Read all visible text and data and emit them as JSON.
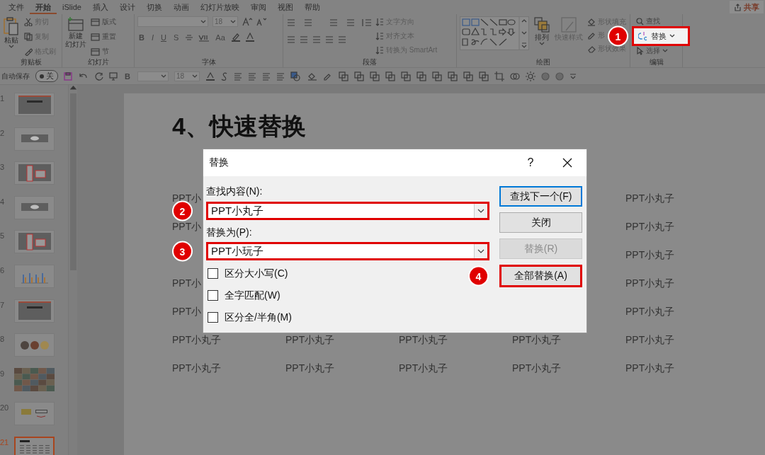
{
  "menu": {
    "tabs": [
      {
        "label": "文件",
        "selected": false
      },
      {
        "label": "开始",
        "selected": true
      },
      {
        "label": "iSlide",
        "selected": false
      },
      {
        "label": "插入",
        "selected": false
      },
      {
        "label": "设计",
        "selected": false
      },
      {
        "label": "切换",
        "selected": false
      },
      {
        "label": "动画",
        "selected": false
      },
      {
        "label": "幻灯片放映",
        "selected": false
      },
      {
        "label": "审阅",
        "selected": false
      },
      {
        "label": "视图",
        "selected": false
      },
      {
        "label": "帮助",
        "selected": false
      }
    ],
    "share": "共享"
  },
  "ribbon": {
    "clipboard": {
      "label": "剪贴板",
      "paste": "粘贴",
      "items": [
        "剪切",
        "复制",
        "格式刷"
      ]
    },
    "slides": {
      "label": "幻灯片",
      "new_slide": [
        "新建",
        "幻灯片"
      ],
      "items": [
        "版式",
        "重置",
        "节"
      ]
    },
    "font": {
      "label": "字体",
      "size": "18",
      "format_buttons": [
        "B",
        "I",
        "U",
        "S"
      ],
      "case_button": "Aa"
    },
    "paragraph": {
      "label": "段落",
      "items": [
        "文字方向",
        "对齐文本",
        "转换为 SmartArt"
      ]
    },
    "drawing": {
      "label": "绘图",
      "arrange": "排列",
      "quick_styles": "快速样式",
      "items": [
        "形状填充",
        "形",
        "形状效果"
      ]
    },
    "editing": {
      "label": "编辑",
      "find": "查找",
      "replace": {
        "label": "替换",
        "highlighted": true,
        "step": "1"
      },
      "select": "选择"
    }
  },
  "quick_access": {
    "autosave": "自动保存",
    "toggle": "关",
    "bold": "B",
    "size": "18"
  },
  "thumbnails": [
    {
      "number": "1",
      "kind": "screen",
      "selected": false
    },
    {
      "number": "2",
      "kind": "bubble",
      "selected": false
    },
    {
      "number": "3",
      "kind": "dialog",
      "selected": false
    },
    {
      "number": "4",
      "kind": "bubble",
      "selected": false
    },
    {
      "number": "5",
      "kind": "dialog",
      "selected": false
    },
    {
      "number": "6",
      "kind": "chart",
      "selected": false
    },
    {
      "number": "7",
      "kind": "screen",
      "selected": false
    },
    {
      "number": "8",
      "kind": "circles",
      "selected": false
    },
    {
      "number": "9",
      "kind": "photos",
      "selected": false
    },
    {
      "number": "20",
      "kind": "poster",
      "selected": false
    },
    {
      "number": "21",
      "kind": "table",
      "selected": true
    }
  ],
  "slide": {
    "title": "4、快速替换",
    "partial_rows": [
      {
        "left": "PPT小",
        "right": "PPT小丸子"
      },
      {
        "left": "PPT小",
        "right": "PPT小丸子"
      },
      {
        "right": "PPT小丸子"
      },
      {
        "left": "PPT小",
        "right": "PPT小丸子"
      },
      {
        "left": "PPT小",
        "right": "PPT小丸子"
      }
    ],
    "full_rows": [
      [
        "PPT小丸子",
        "PPT小丸子",
        "PPT小丸子",
        "PPT小丸子",
        "PPT小丸子"
      ],
      [
        "PPT小丸子",
        "PPT小丸子",
        "PPT小丸子",
        "PPT小丸子",
        "PPT小丸子"
      ]
    ]
  },
  "dialog": {
    "title": "替换",
    "help": "?",
    "find": {
      "label": "查找内容(N):",
      "value": "PPT小丸子",
      "highlighted": true,
      "step": "2"
    },
    "replace": {
      "label": "替换为(P):",
      "value": "PPT小玩子",
      "highlighted": true,
      "step": "3"
    },
    "options": [
      {
        "label": "区分大小写(C)",
        "checked": false
      },
      {
        "label": "全字匹配(W)",
        "checked": false
      },
      {
        "label": "区分全/半角(M)",
        "checked": false
      }
    ],
    "buttons": [
      {
        "label": "查找下一个(F)",
        "default": true,
        "disabled": false,
        "highlighted": false
      },
      {
        "label": "关闭",
        "default": false,
        "disabled": false,
        "highlighted": false
      },
      {
        "label": "替换(R)",
        "default": false,
        "disabled": true,
        "highlighted": false
      },
      {
        "label": "全部替换(A)",
        "default": false,
        "disabled": false,
        "highlighted": true,
        "step": "4"
      }
    ]
  }
}
